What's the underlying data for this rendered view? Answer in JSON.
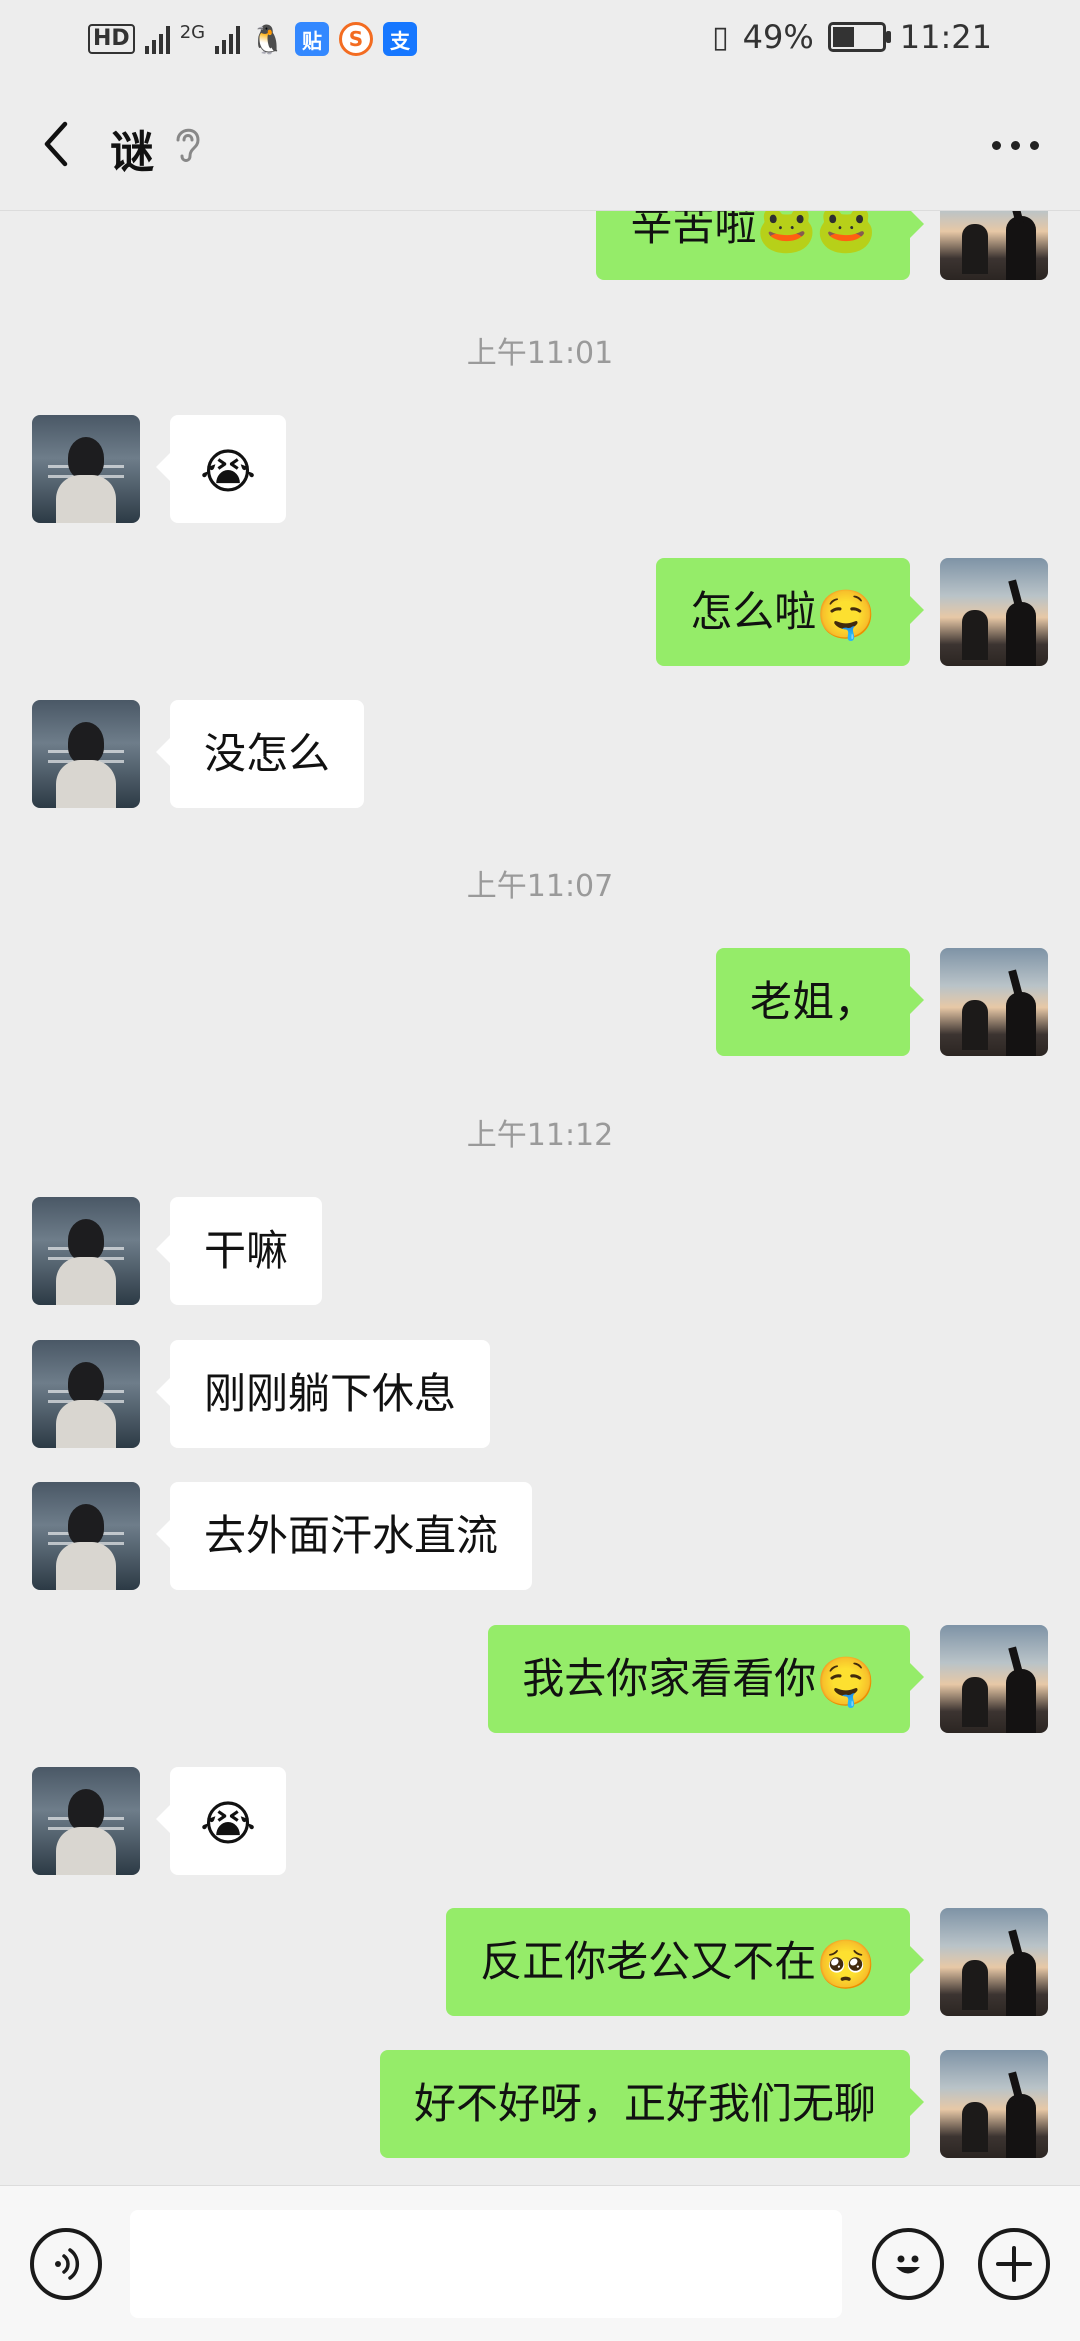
{
  "status_bar": {
    "left_badges": {
      "hd": "HD",
      "net2": "2G"
    },
    "battery_percent": "49%",
    "battery_level": 0.49,
    "time": "11:21",
    "app_icons": [
      "tieba-icon",
      "sogou-icon",
      "alipay-icon"
    ],
    "app_icon_glyphs": {
      "tieba": "贴",
      "sogou": "S",
      "alipay": "支"
    }
  },
  "header": {
    "title": "谜"
  },
  "chat": {
    "top_partial": {
      "text": "辛苦啦",
      "emoji": "🐸🐸"
    },
    "timestamps": [
      "上午11:01",
      "上午11:07",
      "上午11:12"
    ],
    "messages": [
      {
        "from": "her",
        "text": "",
        "emoji": "😭"
      },
      {
        "from": "me",
        "text": "怎么啦",
        "emoji": "🤤"
      },
      {
        "from": "her",
        "text": "没怎么"
      },
      {
        "from": "me",
        "text": "老姐，"
      },
      {
        "from": "her",
        "text": "干嘛"
      },
      {
        "from": "her",
        "text": "刚刚躺下休息"
      },
      {
        "from": "her",
        "text": "去外面汗水直流"
      },
      {
        "from": "me",
        "text": "我去你家看看你",
        "emoji": "🤤"
      },
      {
        "from": "her",
        "text": "",
        "emoji": "😭"
      },
      {
        "from": "me",
        "text": "反正你老公又不在",
        "emoji": "🥺"
      },
      {
        "from": "me",
        "text": "好不好呀，正好我们无聊"
      }
    ]
  },
  "input_bar": {
    "value": "",
    "placeholder": ""
  },
  "colors": {
    "background": "#ededed",
    "outgoing_bubble": "#95ec69",
    "incoming_bubble": "#ffffff",
    "timestamp_text": "#9a9a9a"
  }
}
